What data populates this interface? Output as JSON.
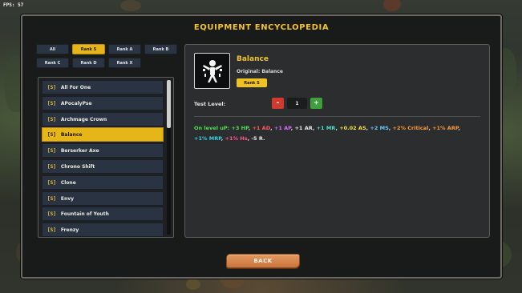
{
  "hud": {
    "fps": "FPS: 57"
  },
  "title": "EQUIPMENT ENCYCLOPEDIA",
  "tabs": [
    "All",
    "Rank S",
    "Rank A",
    "Rank B",
    "Rank C",
    "Rank D",
    "Rank X"
  ],
  "active_tab": "Rank S",
  "items": [
    {
      "tag": "[S]",
      "name": "All For One"
    },
    {
      "tag": "[S]",
      "name": "APocalyPse"
    },
    {
      "tag": "[S]",
      "name": "Archmage Crown"
    },
    {
      "tag": "[S]",
      "name": "Balance"
    },
    {
      "tag": "[S]",
      "name": "Berserker Axe"
    },
    {
      "tag": "[S]",
      "name": "Chrono Shift"
    },
    {
      "tag": "[S]",
      "name": "Clone"
    },
    {
      "tag": "[S]",
      "name": "Envy"
    },
    {
      "tag": "[S]",
      "name": "Fountain of Youth"
    },
    {
      "tag": "[S]",
      "name": "Frenzy"
    }
  ],
  "selected_item": "Balance",
  "details": {
    "name": "Balance",
    "original": "Original: Balance",
    "rank": "Rank S",
    "test_level_label": "Test Level:",
    "level": "1",
    "minus": "-",
    "plus": "+",
    "stats_intro": "On level uP:",
    "stats": [
      {
        "text": "+3 HP",
        "color": "#4fe04f"
      },
      {
        "text": "+1 AD",
        "color": "#ff5a5a"
      },
      {
        "text": "+1 AP",
        "color": "#d96bff"
      },
      {
        "text": "+1 AR",
        "color": "#e8e8e8"
      },
      {
        "text": "+1 MR",
        "color": "#4fe0c8"
      },
      {
        "text": "+0.02 AS",
        "color": "#f5e24a"
      },
      {
        "text": "+2 MS",
        "color": "#66c8ff"
      },
      {
        "text": "+2% Critical",
        "color": "#ff9a3c"
      },
      {
        "text": "+1% ARP",
        "color": "#ff9a3c"
      },
      {
        "text": "+1% MRP",
        "color": "#38d4e6"
      },
      {
        "text": "+1% Hs",
        "color": "#ff5a8c"
      },
      {
        "text": "-5 R.",
        "color": "#e8e8e8"
      }
    ],
    "stats_intro_color": "#4fe04f"
  },
  "back_label": "BACK",
  "icon": "balance-figure-icon",
  "colors": {
    "accent": "#f2c230",
    "panel": "#191b1a",
    "tab": "#2b3442"
  }
}
